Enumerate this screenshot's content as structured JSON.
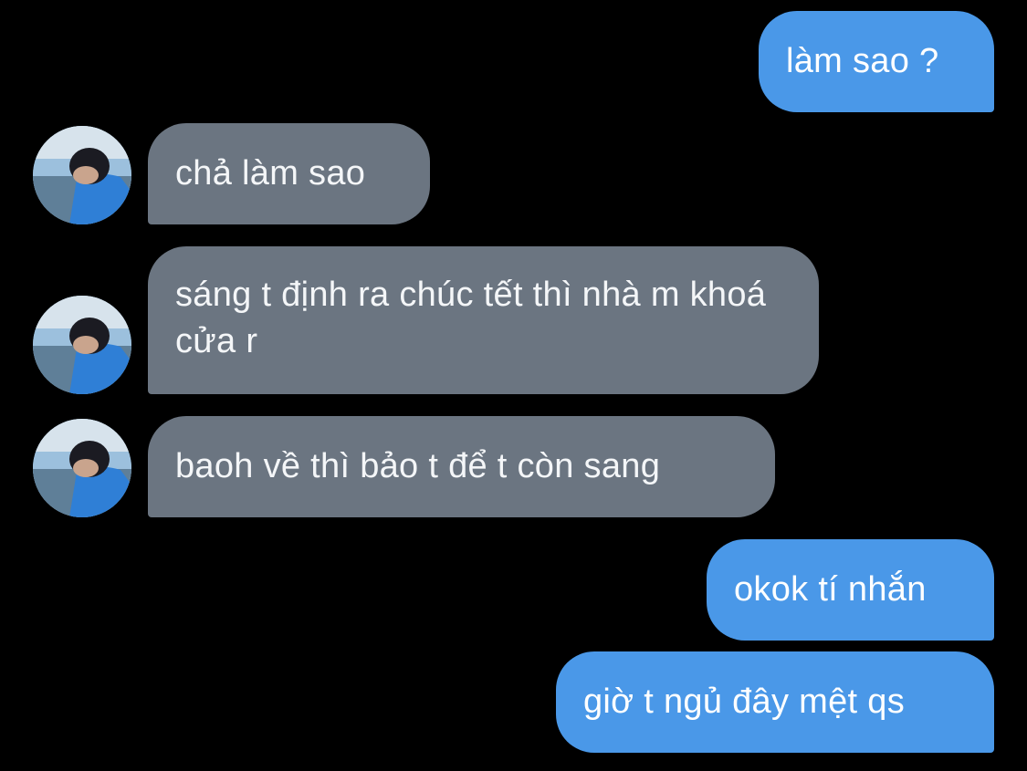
{
  "conversation": {
    "messages": [
      {
        "sender": "me",
        "text": "làm sao ?"
      },
      {
        "sender": "them",
        "text": "chả làm sao",
        "avatar": "avatar-photo-icon"
      },
      {
        "sender": "them",
        "text": "sáng t định ra chúc tết thì nhà m khoá cửa r",
        "avatar": "avatar-photo-icon"
      },
      {
        "sender": "them",
        "text": "baoh về thì bảo t để t còn sang",
        "avatar": "avatar-photo-icon"
      },
      {
        "sender": "me",
        "text": "okok tí nhắn"
      },
      {
        "sender": "me",
        "text": "giờ t ngủ đây mệt qs"
      }
    ]
  },
  "colors": {
    "background": "#000000",
    "sent_bubble": "#4a98e8",
    "received_bubble": "#6b7581",
    "text": "#ffffff"
  }
}
